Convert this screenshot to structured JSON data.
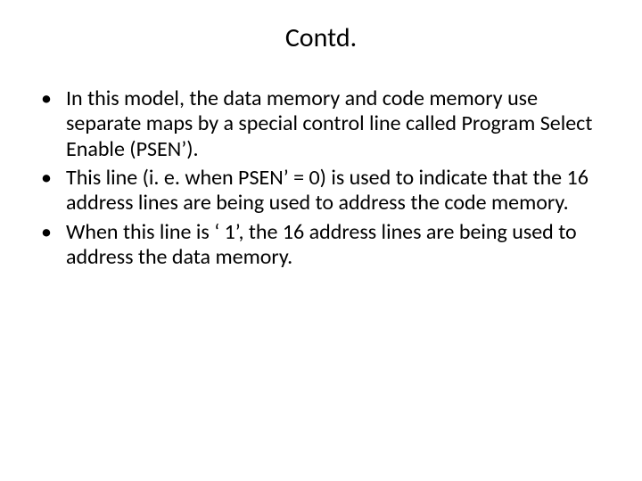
{
  "title": "Contd.",
  "bullets": [
    "In this model, the data memory and code memory use separate maps by a special control line called Program Select Enable (PSEN’).",
    "This line (i. e. when PSEN’ = 0) is used to indicate that the 16 address lines are being used to address the code memory.",
    "When this line is ‘ 1’, the 16 address lines are being used to address the data memory."
  ]
}
